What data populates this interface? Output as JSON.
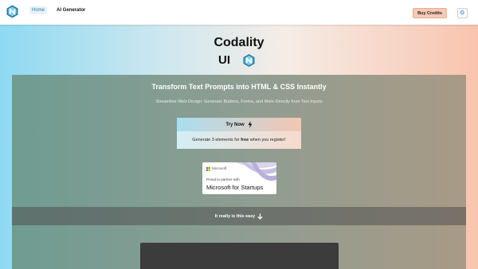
{
  "header": {
    "nav": {
      "home_label": "Home",
      "ai_generator_label": "AI Generator"
    },
    "buy_credits_label": "Buy Credits",
    "google_glyph": "G"
  },
  "brand": {
    "title": "Codality",
    "subtitle": "UI"
  },
  "hero": {
    "title": "Transform Text Prompts into HTML & CSS Instantly",
    "subtitle": "Streamline Web Design: Generate Buttons, Forms, and More Directly from Text Inputs"
  },
  "cta": {
    "try_now_label": "Try Now",
    "note_before": "Generate 3 elements for ",
    "note_bold": "free",
    "note_after": " when you register!"
  },
  "partner": {
    "ms_word": "Microsoft",
    "proud_text": "Proud to partner with",
    "startups_text": "Microsoft for Startups"
  },
  "easy": {
    "label": "It really is this easy"
  },
  "colors": {
    "accent_blue": "#8fd9f2",
    "accent_peach": "#f8c4ae",
    "buy_button": "#f6c9b6",
    "panel_left": "#6f9c92",
    "panel_right": "#a99a86",
    "demo_box": "#3c3c3c"
  },
  "icons": {
    "logo": "cube-n-logo-icon",
    "try_now": "lightning-bolt-icon",
    "easy": "arrow-down-icon",
    "google": "google-icon",
    "microsoft": "microsoft-logo-icon"
  }
}
